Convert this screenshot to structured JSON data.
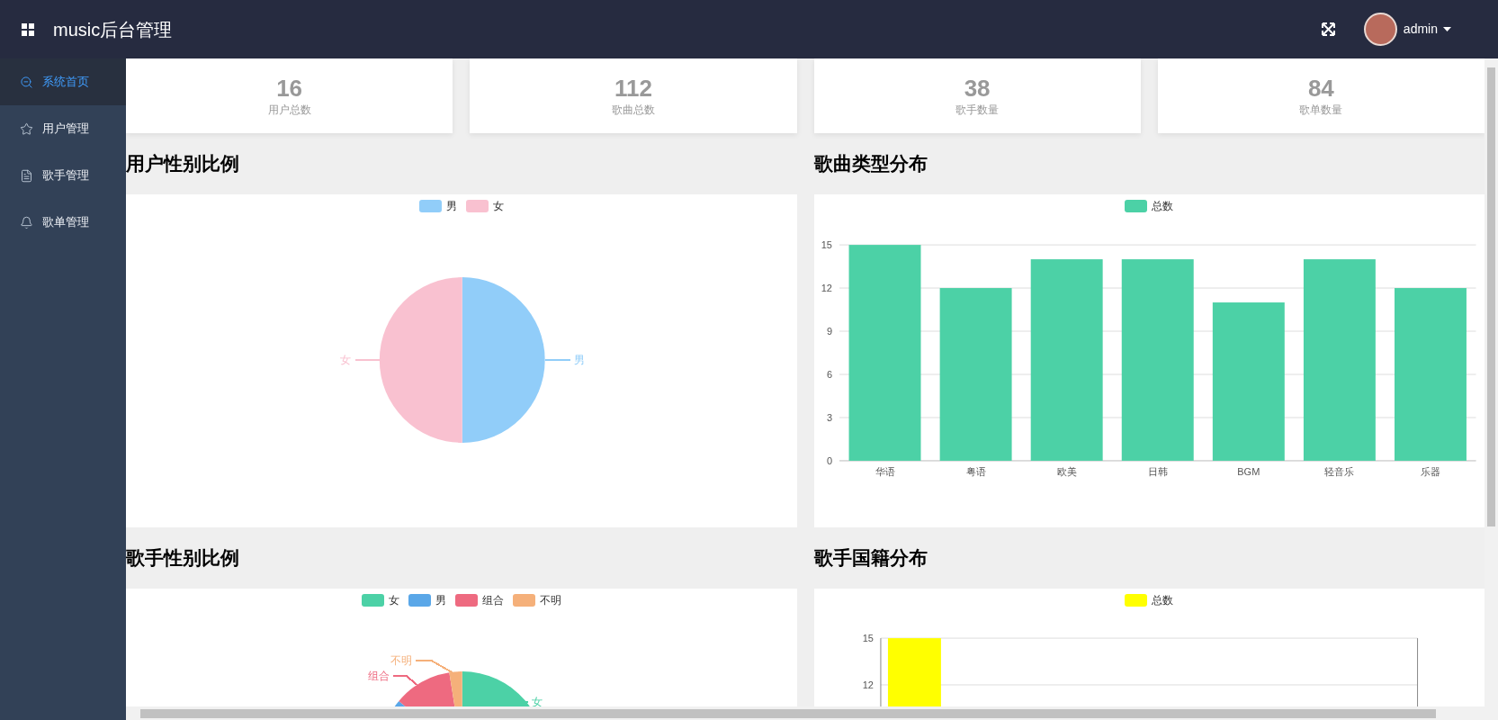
{
  "header": {
    "title": "music后台管理",
    "user": "admin"
  },
  "sidebar": {
    "items": [
      {
        "label": "系统首页",
        "selected": true
      },
      {
        "label": "用户管理",
        "selected": false
      },
      {
        "label": "歌手管理",
        "selected": false
      },
      {
        "label": "歌单管理",
        "selected": false
      }
    ]
  },
  "stats": [
    {
      "value": "16",
      "label": "用户总数"
    },
    {
      "value": "112",
      "label": "歌曲总数"
    },
    {
      "value": "38",
      "label": "歌手数量"
    },
    {
      "value": "84",
      "label": "歌单数量"
    }
  ],
  "panels": [
    {
      "title": "用户性别比例",
      "legend": [
        {
          "label": "男",
          "color": "#91cdf9"
        },
        {
          "label": "女",
          "color": "#f9c1d0"
        }
      ],
      "callouts": [
        "女",
        "男"
      ]
    },
    {
      "title": "歌曲类型分布",
      "chart_data": {
        "type": "bar",
        "categories": [
          "华语",
          "粤语",
          "欧美",
          "日韩",
          "BGM",
          "轻音乐",
          "乐器"
        ],
        "series": [
          {
            "name": "总数",
            "color": "#4cd1a6",
            "values": [
              15,
              12,
              14,
              14,
              11,
              14,
              12
            ]
          }
        ],
        "ylim": [
          0,
          15
        ],
        "yticks": [
          0,
          3,
          6,
          9,
          12,
          15
        ],
        "grid": true
      }
    },
    {
      "title": "歌手性别比例",
      "legend": [
        {
          "label": "女",
          "color": "#4cd1a6"
        },
        {
          "label": "男",
          "color": "#5aa7e8"
        },
        {
          "label": "组合",
          "color": "#ee6a80"
        },
        {
          "label": "不明",
          "color": "#f5b07a"
        }
      ],
      "callouts": [
        "不明",
        "组合",
        "女"
      ]
    },
    {
      "title": "歌手国籍分布",
      "chart_data": {
        "type": "bar",
        "series": [
          {
            "name": "总数",
            "color": "#ffff00",
            "values": [
              15
            ]
          }
        ],
        "ylim": [
          0,
          15
        ],
        "yticks": [
          12,
          15
        ],
        "grid": true
      }
    }
  ]
}
